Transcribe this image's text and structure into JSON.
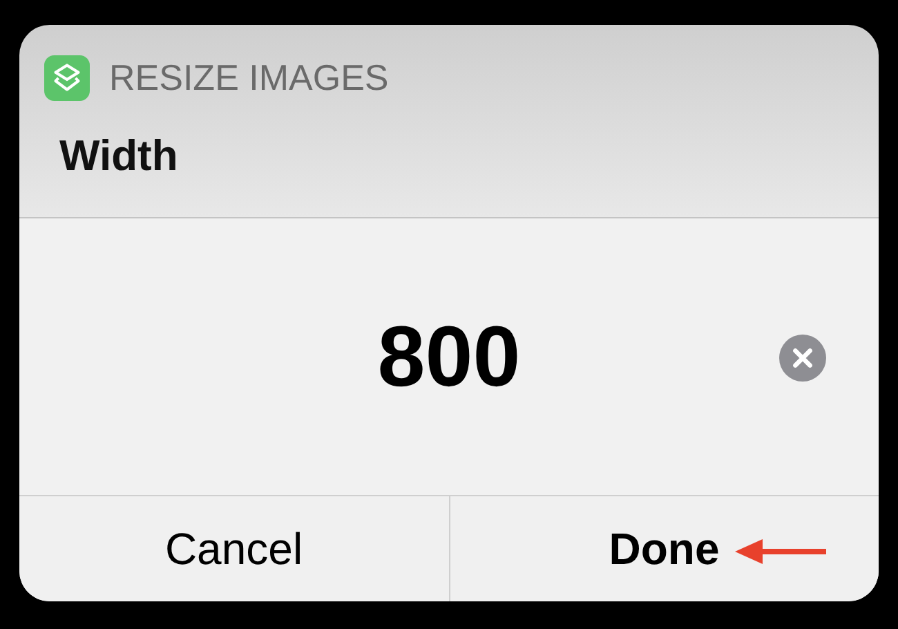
{
  "dialog": {
    "app_name": "RESIZE IMAGES",
    "prompt": "Width"
  },
  "field": {
    "value": "800"
  },
  "buttons": [
    {
      "label": "Cancel",
      "kind": "cancel",
      "arrow_annotation": false
    },
    {
      "label": "Done",
      "kind": "default",
      "arrow_annotation": true
    }
  ]
}
